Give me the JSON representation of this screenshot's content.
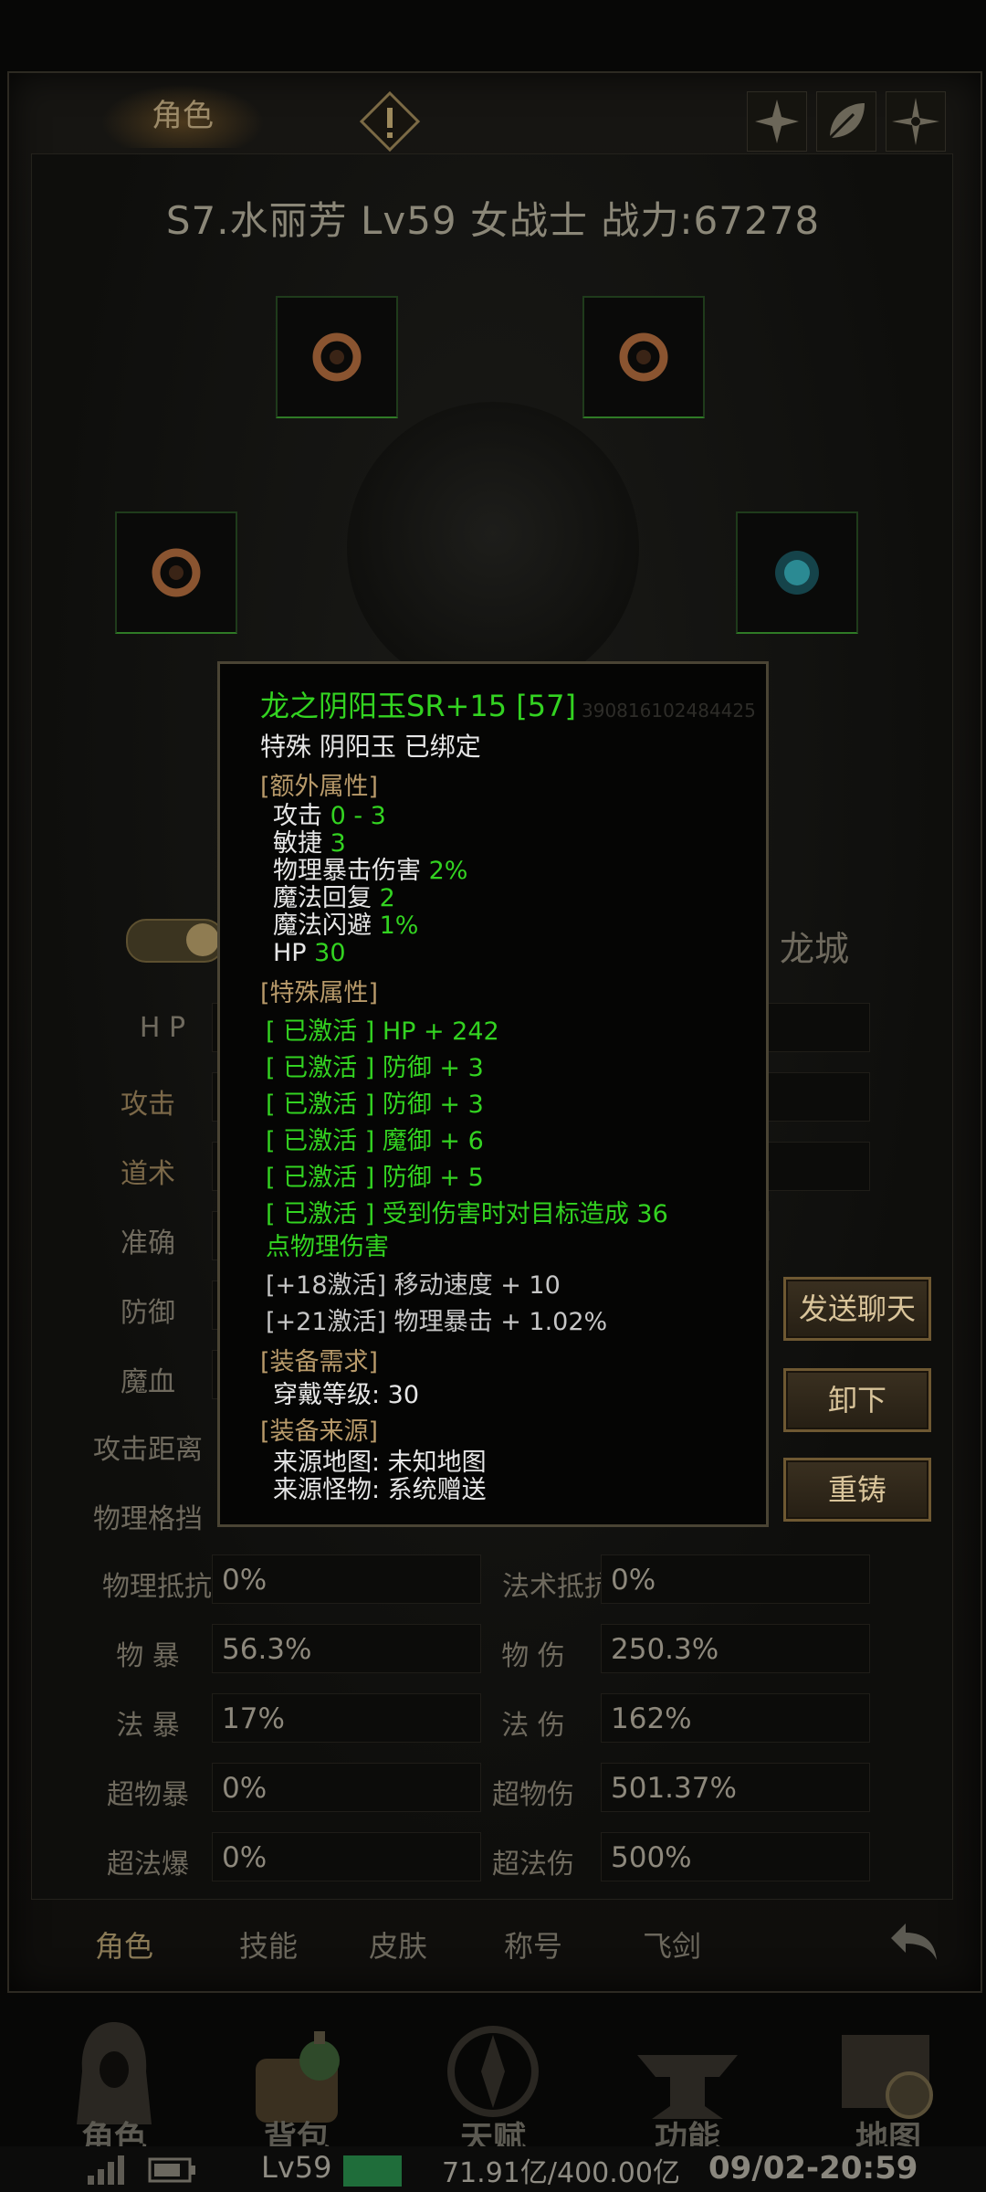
{
  "header": {
    "tab_role": "角色",
    "title": "S7.水丽芳 Lv59 女战士     战力:67278"
  },
  "toggle": {
    "label_right": "龙城"
  },
  "stats": {
    "left": [
      {
        "label": "H P",
        "value": ""
      },
      {
        "label": "攻击",
        "value": ""
      },
      {
        "label": "道术",
        "value": ""
      },
      {
        "label": "准确",
        "value": ""
      },
      {
        "label": "防御",
        "value": ""
      },
      {
        "label": "魔血",
        "value": ""
      },
      {
        "label": "攻击距离",
        "value": ""
      },
      {
        "label": "物理格挡",
        "value": ""
      },
      {
        "label": "物理抵抗",
        "value": "0%"
      },
      {
        "label": "物 暴",
        "value": "56.3%"
      },
      {
        "label": "法 暴",
        "value": "17%"
      },
      {
        "label": "超物暴",
        "value": "0%"
      },
      {
        "label": "超法爆",
        "value": "0%"
      }
    ],
    "right": [
      {
        "label": "法术抵抗",
        "value": "0%"
      },
      {
        "label": "物 伤",
        "value": "250.3%"
      },
      {
        "label": "法 伤",
        "value": "162%"
      },
      {
        "label": "超物伤",
        "value": "501.37%"
      },
      {
        "label": "超法伤",
        "value": "500%"
      }
    ]
  },
  "buttons": {
    "chat": "发送聊天",
    "unequip": "卸下",
    "recast": "重铸"
  },
  "tooltip": {
    "name": "龙之阴阳玉SR+15 [57]",
    "sub": "特殊 阴阳玉  已绑定",
    "id": "390816102484425",
    "extra_title": "[额外属性]",
    "extra": [
      {
        "k": "攻击 ",
        "v": "0 - 3"
      },
      {
        "k": "敏捷 ",
        "v": "3"
      },
      {
        "k": "物理暴击伤害 ",
        "v": "2%"
      },
      {
        "k": "魔法回复 ",
        "v": "2"
      },
      {
        "k": "魔法闪避 ",
        "v": "1%"
      },
      {
        "k": "HP ",
        "v": "30"
      }
    ],
    "special_title": "[特殊属性]",
    "special": [
      "[  已激活 ] HP + 242",
      "[  已激活 ] 防御 + 3",
      "[  已激活 ] 防御 + 3",
      "[  已激活 ] 魔御 + 6",
      "[  已激活 ] 防御 + 5",
      "[  已激活 ] 受到伤害时对目标造成 36",
      "点物理伤害"
    ],
    "inactive": [
      "[+18激活] 移动速度 + 10",
      "[+21激活] 物理暴击 + 1.02%"
    ],
    "req_title": "[装备需求]",
    "req": "穿戴等级: 30",
    "src_title": "[装备来源]",
    "src_map": "来源地图:   未知地图",
    "src_monster": "来源怪物:   系统赠送"
  },
  "bottom_tabs": [
    "角色",
    "技能",
    "皮肤",
    "称号",
    "飞剑"
  ],
  "nav": [
    "角色",
    "背包",
    "天赋",
    "功能",
    "地图"
  ],
  "status": {
    "level": "Lv59",
    "money": "71.91亿/400.00亿",
    "time": "09/02-20:59"
  }
}
